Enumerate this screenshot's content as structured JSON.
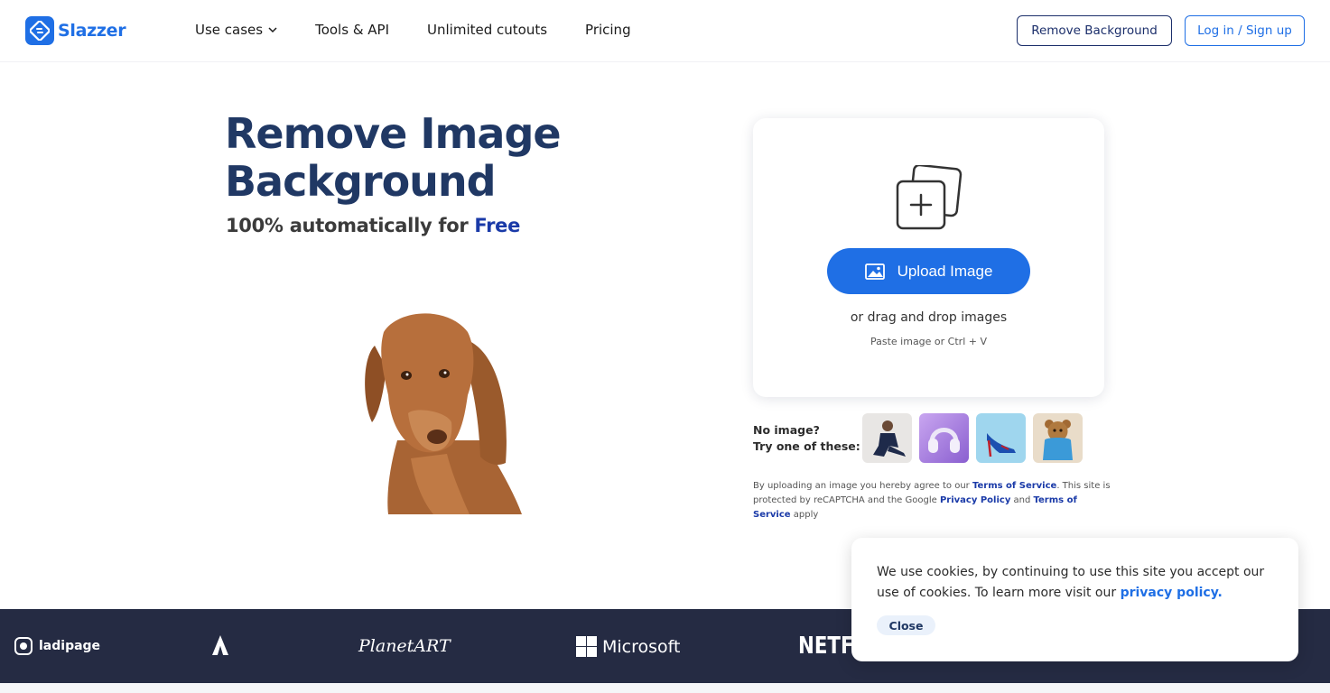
{
  "header": {
    "brand": "Slazzer",
    "nav": [
      {
        "label": "Use cases"
      },
      {
        "label": "Tools & API"
      },
      {
        "label": "Unlimited cutouts"
      },
      {
        "label": "Pricing"
      }
    ],
    "remove_bg_label": "Remove Background",
    "login_label": "Log in / Sign up"
  },
  "hero": {
    "title_line1": "Remove Image",
    "title_line2": "Background",
    "subtitle_prefix": "100% automatically for ",
    "subtitle_highlight": "Free"
  },
  "upload": {
    "button_label": "Upload Image",
    "drag_text": "or drag and drop images",
    "paste_text": "Paste image or Ctrl + V"
  },
  "samples": {
    "line1": "No image?",
    "line2": "Try one of these:"
  },
  "terms": {
    "part1": "By uploading an image you hereby agree to our ",
    "link1": "Terms of Service",
    "part2": ". This site is protected by reCAPTCHA and the Google ",
    "link2": "Privacy Policy",
    "part3": " and ",
    "link3": "Terms of Service",
    "part4": " apply"
  },
  "brands": {
    "ladipage": "ladipage",
    "planetart": "PlanetART",
    "microsoft": "Microsoft",
    "netflix": "NETFLIX"
  },
  "cookie": {
    "text": "We use cookies, by continuing to use this site you accept our use of cookies. To learn more visit our ",
    "link": "privacy policy.",
    "close_label": "Close"
  },
  "colors": {
    "primary": "#1f6fe5",
    "navy": "#203864",
    "band": "#252b43"
  }
}
